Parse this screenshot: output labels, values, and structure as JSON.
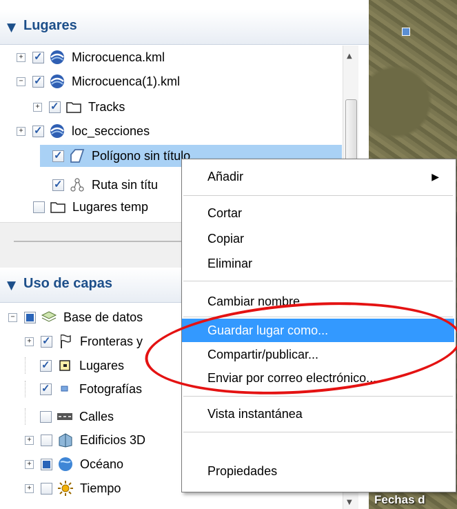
{
  "places_panel": {
    "title": "Lugares",
    "items": [
      {
        "label": "Microcuenca.kml"
      },
      {
        "label": "Microcuenca(1).kml"
      },
      {
        "label": "Tracks"
      },
      {
        "label": "loc_secciones"
      },
      {
        "label": "Polígono sin título"
      },
      {
        "label": "Ruta sin títu"
      },
      {
        "label": "Lugares temp"
      }
    ]
  },
  "layers_panel": {
    "title": "Uso de capas",
    "items": [
      {
        "label": "Base de datos"
      },
      {
        "label": "Fronteras y"
      },
      {
        "label": "Lugares"
      },
      {
        "label": "Fotografías"
      },
      {
        "label": "Calles"
      },
      {
        "label": "Edificios 3D"
      },
      {
        "label": "Océano"
      },
      {
        "label": "Tiempo"
      }
    ]
  },
  "map": {
    "caption": "Fechas d"
  },
  "context_menu": {
    "items": [
      {
        "label": "Añadir"
      },
      {
        "label": "Cortar"
      },
      {
        "label": "Copiar"
      },
      {
        "label": "Eliminar"
      },
      {
        "label": "Cambiar nombre"
      },
      {
        "label": "Guardar lugar como..."
      },
      {
        "label": "Compartir/publicar..."
      },
      {
        "label": "Enviar por correo electrónico..."
      },
      {
        "label": "Vista instantánea"
      },
      {
        "label": "Propiedades"
      }
    ],
    "highlighted": "Guardar lugar como...",
    "highlight_color": "#3399ff"
  },
  "annotation_color": "#e41212"
}
